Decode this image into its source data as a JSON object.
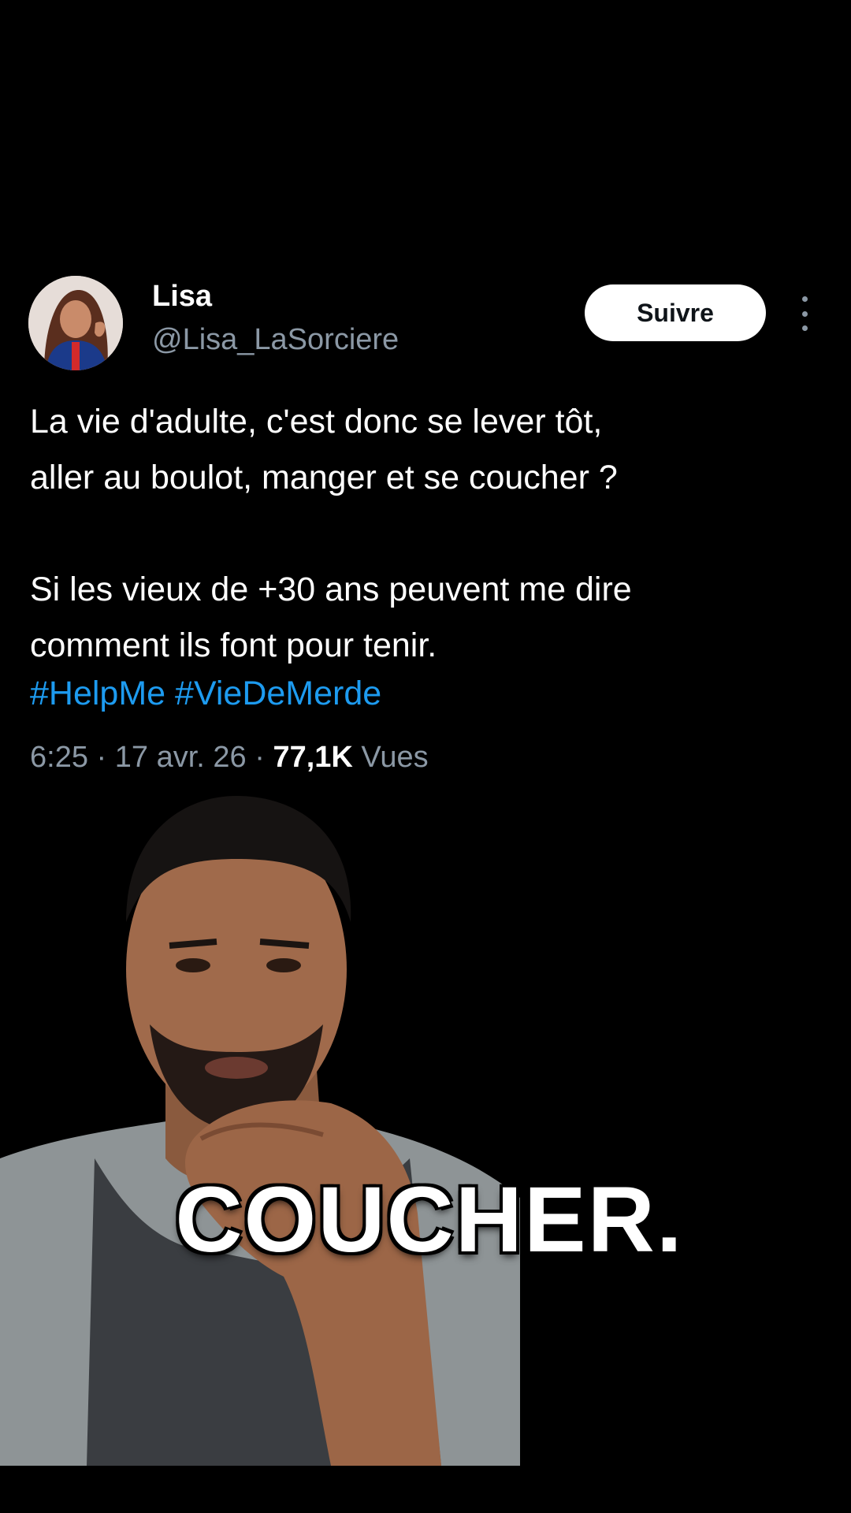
{
  "tweet": {
    "display_name": "Lisa",
    "handle": "@Lisa_LaSorciere",
    "follow_label": "Suivre",
    "text_lines": [
      "La vie d'adulte, c'est donc se lever tôt,",
      "aller au boulot, manger et se coucher ?",
      "Si les vieux de +30 ans peuvent me dire",
      "comment ils font pour tenir."
    ],
    "hashtags": [
      "#HelpMe",
      "#VieDeMerde"
    ],
    "time": "6:25",
    "date": "17 avr. 26",
    "views_count": "77,1K",
    "views_label": "Vues"
  },
  "video": {
    "caption": "COUCHER."
  },
  "colors": {
    "background": "#000000",
    "hashtag": "#1d9bf0",
    "secondary_text": "#8b98a5",
    "follow_button_bg": "#ffffff"
  },
  "icons": {
    "more": "more-vertical-icon",
    "avatar": "profile-avatar"
  }
}
